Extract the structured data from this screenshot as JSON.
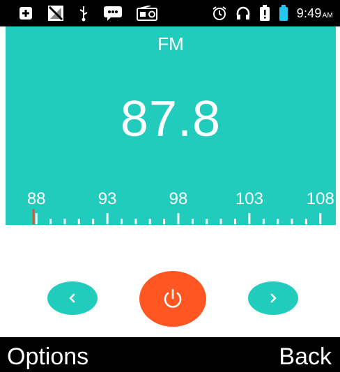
{
  "status_bar": {
    "icons_left": [
      "add-box-icon",
      "signal-slash-icon",
      "usb-icon",
      "chat-icon",
      "radio-icon"
    ],
    "icons_right": [
      "alarm-icon",
      "headphones-icon",
      "battery-alert-icon",
      "battery-icon"
    ],
    "time": "9:49",
    "ampm": "AM"
  },
  "radio": {
    "band": "FM",
    "frequency": "87.8",
    "scale_labels": [
      "88",
      "93",
      "98",
      "103",
      "108"
    ],
    "scale_min": 87.5,
    "scale_max": 108.5,
    "tuned_frequency": 87.8,
    "colors": {
      "panel": "#22ccbd",
      "needle": "#e0522a",
      "power": "#ff5622"
    }
  },
  "controls": {
    "prev_icon": "chevron-left-icon",
    "power_icon": "power-icon",
    "next_icon": "chevron-right-icon"
  },
  "softkeys": {
    "left": "Options",
    "right": "Back"
  }
}
